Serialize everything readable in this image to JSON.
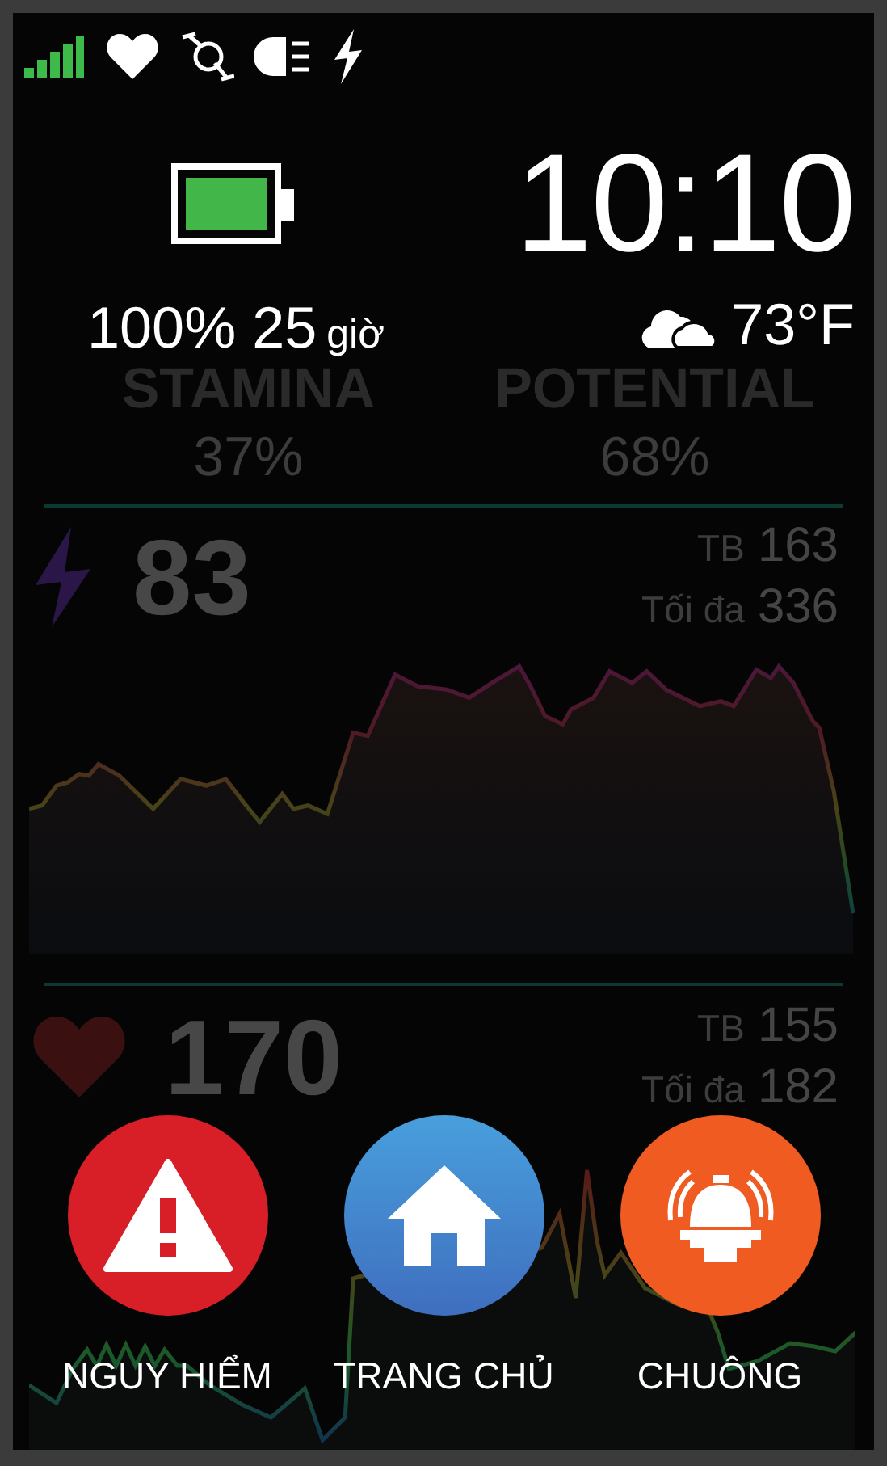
{
  "clock": {
    "time": "10:10"
  },
  "battery": {
    "percent": "100%",
    "hours": "25",
    "unit": "giờ"
  },
  "weather": {
    "temperature": "73°F"
  },
  "fields": [
    {
      "label": "STAMINA",
      "value": "37%"
    },
    {
      "label": "POTENTIAL",
      "value": "68%"
    }
  ],
  "panels": [
    {
      "kind": "power",
      "value": "83",
      "stats": [
        {
          "label": "TB",
          "value": "163"
        },
        {
          "label": "Tối đa",
          "value": "336"
        }
      ]
    },
    {
      "kind": "heart_rate",
      "value": "170",
      "stats": [
        {
          "label": "TB",
          "value": "155"
        },
        {
          "label": "Tối đa",
          "value": "182"
        }
      ]
    }
  ],
  "actions": [
    {
      "kind": "danger",
      "label": "NGUY HIỂM"
    },
    {
      "kind": "home",
      "label": "TRANG CHỦ"
    },
    {
      "kind": "bell",
      "label": "CHUÔNG"
    }
  ]
}
